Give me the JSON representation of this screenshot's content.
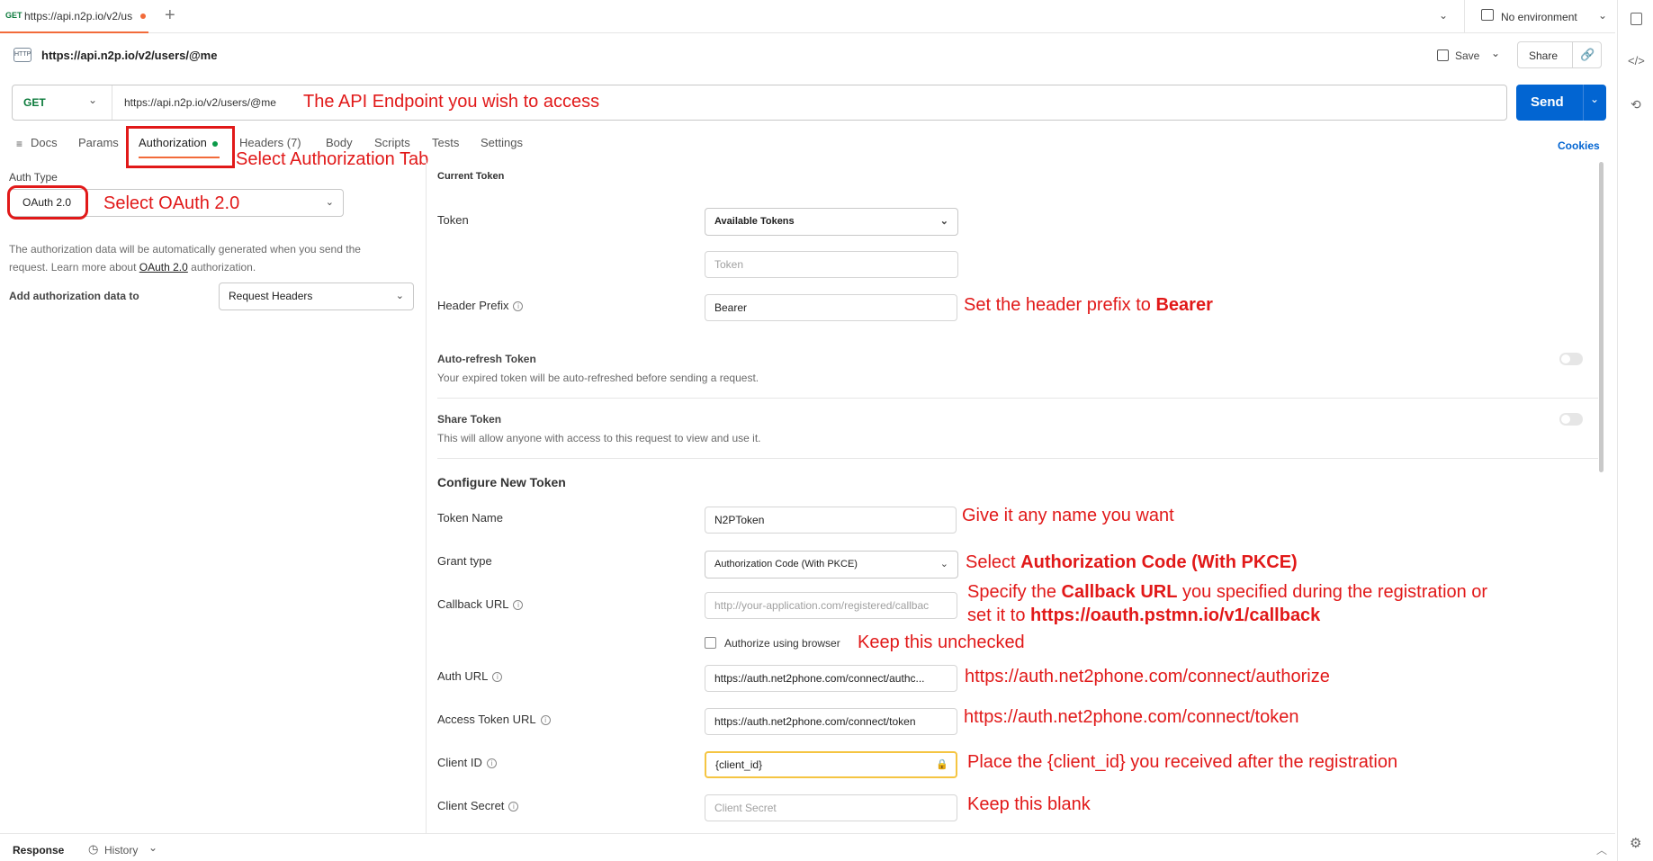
{
  "tab": {
    "method": "GET",
    "url": "https://api.n2p.io/v2/us"
  },
  "environment": "No environment",
  "request": {
    "name": "https://api.n2p.io/v2/users/@me",
    "save": "Save",
    "share": "Share",
    "method": "GET",
    "url": "https://api.n2p.io/v2/users/@me",
    "send": "Send"
  },
  "tabs": [
    "Docs",
    "Params",
    "Authorization",
    "Headers (7)",
    "Body",
    "Scripts",
    "Tests",
    "Settings"
  ],
  "cookies": "Cookies",
  "left": {
    "auth_type_label": "Auth Type",
    "auth_type_value": "OAuth 2.0",
    "desc_1": "The authorization data will be automatically generated when you send the",
    "desc_2a": "request. Learn more about ",
    "desc_link": "OAuth 2.0",
    "desc_2b": " authorization.",
    "add_to_label": "Add authorization data to",
    "add_to_value": "Request Headers"
  },
  "current_token": {
    "heading": "Current Token",
    "token_label": "Token",
    "token_select": "Available Tokens",
    "token_placeholder": "Token",
    "header_prefix_label": "Header Prefix",
    "header_prefix_value": "Bearer",
    "auto_refresh_title": "Auto-refresh Token",
    "auto_refresh_desc": "Your expired token will be auto-refreshed before sending a request.",
    "share_title": "Share Token",
    "share_desc": "This will allow anyone with access to this request to view and use it."
  },
  "configure": {
    "heading": "Configure New Token",
    "token_name_label": "Token Name",
    "token_name_value": "N2PToken",
    "grant_type_label": "Grant type",
    "grant_type_value": "Authorization Code (With PKCE)",
    "callback_label": "Callback URL",
    "callback_placeholder": "http://your-application.com/registered/callbac",
    "authorize_browser": "Authorize using browser",
    "auth_url_label": "Auth URL",
    "auth_url_value": "https://auth.net2phone.com/connect/authc...",
    "access_token_label": "Access Token URL",
    "access_token_value": "https://auth.net2phone.com/connect/token",
    "client_id_label": "Client ID",
    "client_id_value": "{client_id}",
    "client_secret_label": "Client Secret",
    "client_secret_placeholder": "Client Secret"
  },
  "annotations": {
    "endpoint": "The API Endpoint you wish to access",
    "auth_tab": "Select Authorization Tab",
    "oauth": "Select OAuth 2.0",
    "prefix_a": "Set the header prefix to ",
    "prefix_b": "Bearer",
    "name": "Give it any name you want",
    "grant_a": "Select ",
    "grant_b": "Authorization Code (With PKCE)",
    "callback1_a": "Specify the ",
    "callback1_b": "Callback URL",
    "callback1_c": " you specified during the registration or",
    "callback2_a": "set it to ",
    "callback2_b": "https://oauth.pstmn.io/v1/callback",
    "unchecked": "Keep this unchecked",
    "auth_url": "https://auth.net2phone.com/connect/authorize",
    "token_url": "https://auth.net2phone.com/connect/token",
    "client_id": "Place the {client_id} you received after the registration",
    "blank": "Keep this blank"
  },
  "bottom": {
    "response": "Response",
    "history": "History"
  },
  "colors": {
    "accent": "#0265d2",
    "annotation": "#e11919",
    "tab_underline": "#f26b3a"
  }
}
